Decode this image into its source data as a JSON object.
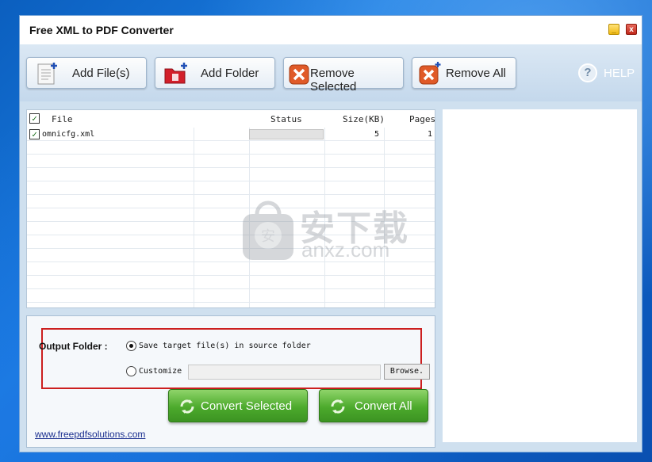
{
  "window": {
    "title": "Free XML to PDF Converter",
    "minimize_glyph": "_",
    "close_glyph": "x"
  },
  "toolbar": {
    "add_files": "Add File(s)",
    "add_folder": "Add Folder",
    "remove_selected": "Remove Selected",
    "remove_all": "Remove All",
    "help": "HELP",
    "help_glyph": "?"
  },
  "file_list": {
    "columns": {
      "file": "File",
      "status": "Status",
      "size": "Size(KB)",
      "pages": "Pages"
    },
    "rows": [
      {
        "name": "omnicfg.xml",
        "size": "5",
        "pages": "1",
        "checked": true,
        "progress": 0
      }
    ]
  },
  "output": {
    "label": "Output Folder :",
    "option_source": "Save target file(s) in source folder",
    "option_custom": "Customize",
    "custom_path": "",
    "browse": "Browse.",
    "selected": "source"
  },
  "actions": {
    "convert_selected": "Convert Selected",
    "convert_all": "Convert All"
  },
  "footer": {
    "website": "www.freepdfsolutions.com"
  },
  "watermark": {
    "cn": "安下载",
    "en": "anxz.com"
  },
  "colors": {
    "accent_green": "#4caa2c",
    "highlight_red": "#cc1f1f",
    "toolbar_blue": "#c4d8ec"
  },
  "icons": {
    "add_files": "document-add-icon",
    "add_folder": "folder-add-icon",
    "remove_selected": "remove-icon",
    "remove_all": "remove-all-icon",
    "help": "help-icon",
    "convert": "refresh-icon"
  }
}
